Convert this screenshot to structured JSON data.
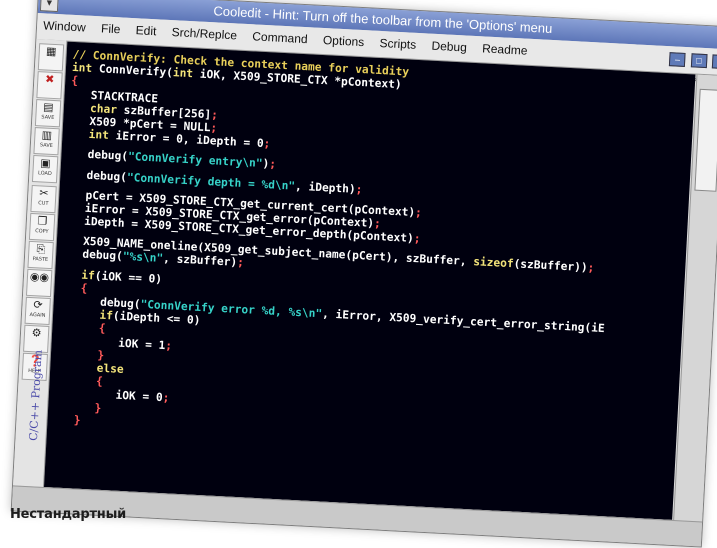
{
  "window": {
    "title": "Cooledit - Hint: Turn off the toolbar from the 'Options' menu",
    "system_menu_icon": "chevron-down-icon",
    "controls": [
      "minimize-icon",
      "maximize-icon",
      "close-icon"
    ]
  },
  "menu": {
    "items": [
      {
        "id": "window",
        "label": "Window"
      },
      {
        "id": "file",
        "label": "File"
      },
      {
        "id": "edit",
        "label": "Edit"
      },
      {
        "id": "srch-replace",
        "label": "Srch/Replce"
      },
      {
        "id": "command",
        "label": "Command"
      },
      {
        "id": "options",
        "label": "Options"
      },
      {
        "id": "scripts",
        "label": "Scripts"
      },
      {
        "id": "debug",
        "label": "Debug"
      },
      {
        "id": "readme",
        "label": "Readme"
      }
    ]
  },
  "toolbar": {
    "buttons": [
      {
        "id": "open",
        "icon": "open-folder-icon",
        "label": ""
      },
      {
        "id": "close",
        "icon": "close-icon",
        "label": ""
      },
      {
        "id": "save",
        "icon": "save-icon",
        "label": "SAVE"
      },
      {
        "id": "save-as",
        "icon": "save-as-icon",
        "label": "SAVE"
      },
      {
        "id": "load",
        "icon": "load-icon",
        "label": "LOAD"
      },
      {
        "id": "cut",
        "icon": "cut-icon",
        "label": "CUT"
      },
      {
        "id": "copy",
        "icon": "copy-icon",
        "label": "COPY"
      },
      {
        "id": "paste",
        "icon": "paste-icon",
        "label": "PASTE"
      },
      {
        "id": "search",
        "icon": "binoculars-icon",
        "label": ""
      },
      {
        "id": "again",
        "icon": "search-again-icon",
        "label": "AGAIN"
      },
      {
        "id": "run",
        "icon": "run-icon",
        "label": ""
      },
      {
        "id": "help",
        "icon": "help-icon",
        "label": "HELP"
      }
    ],
    "vertical_label": "C/C++ Program"
  },
  "editor": {
    "colors": {
      "background": "#00000f",
      "comment": "#e8cf5a",
      "keyword": "#f2e37a",
      "string": "#36d2c8",
      "punctuation": "#ff5a5a",
      "identifier": "#ffffff"
    },
    "lines": [
      [
        {
          "t": "// ConnVerify: Check the context name for validity",
          "c": "comment"
        }
      ],
      [
        {
          "t": "int ",
          "c": "type"
        },
        {
          "t": "ConnVerify(",
          "c": "id"
        },
        {
          "t": "int ",
          "c": "type"
        },
        {
          "t": "iOK, X509_STORE_CTX *pContext)",
          "c": "id"
        }
      ],
      [
        {
          "t": "{",
          "c": "punc"
        }
      ],
      [
        {
          "t": "   STACKTRACE",
          "c": "id"
        }
      ],
      [
        {
          "t": "   char ",
          "c": "type"
        },
        {
          "t": "szBuffer[256]",
          "c": "id"
        },
        {
          "t": ";",
          "c": "punc"
        }
      ],
      [
        {
          "t": "   X509 *pCert = NULL",
          "c": "id"
        },
        {
          "t": ";",
          "c": "punc"
        }
      ],
      [
        {
          "t": "   int ",
          "c": "type"
        },
        {
          "t": "iError = 0, iDepth = 0",
          "c": "id"
        },
        {
          "t": ";",
          "c": "punc"
        }
      ],
      [],
      [
        {
          "t": "   debug(",
          "c": "id"
        },
        {
          "t": "\"ConnVerify entry\\n\"",
          "c": "str"
        },
        {
          "t": ")",
          "c": "id"
        },
        {
          "t": ";",
          "c": "punc"
        }
      ],
      [],
      [
        {
          "t": "   debug(",
          "c": "id"
        },
        {
          "t": "\"ConnVerify depth = %d\\n\"",
          "c": "str"
        },
        {
          "t": ", iDepth)",
          "c": "id"
        },
        {
          "t": ";",
          "c": "punc"
        }
      ],
      [],
      [
        {
          "t": "   pCert = X509_STORE_CTX_get_current_cert(pContext)",
          "c": "id"
        },
        {
          "t": ";",
          "c": "punc"
        }
      ],
      [
        {
          "t": "   iError = X509_STORE_CTX_get_error(pContext)",
          "c": "id"
        },
        {
          "t": ";",
          "c": "punc"
        }
      ],
      [
        {
          "t": "   iDepth = X509_STORE_CTX_get_error_depth(pContext)",
          "c": "id"
        },
        {
          "t": ";",
          "c": "punc"
        }
      ],
      [],
      [
        {
          "t": "   X509_NAME_oneline(X509_get_subject_name(pCert), szBuffer, ",
          "c": "id"
        },
        {
          "t": "sizeof",
          "c": "kw"
        },
        {
          "t": "(szBuffer))",
          "c": "id"
        },
        {
          "t": ";",
          "c": "punc"
        }
      ],
      [
        {
          "t": "   debug(",
          "c": "id"
        },
        {
          "t": "\"%s\\n\"",
          "c": "str"
        },
        {
          "t": ", szBuffer)",
          "c": "id"
        },
        {
          "t": ";",
          "c": "punc"
        }
      ],
      [],
      [
        {
          "t": "   if",
          "c": "kw"
        },
        {
          "t": "(iOK == 0)",
          "c": "id"
        }
      ],
      [
        {
          "t": "   {",
          "c": "punc"
        }
      ],
      [
        {
          "t": "      debug(",
          "c": "id"
        },
        {
          "t": "\"ConnVerify error %d, %s\\n\"",
          "c": "str"
        },
        {
          "t": ", iError, X509_verify_cert_error_string(iE",
          "c": "id"
        }
      ],
      [
        {
          "t": "      if",
          "c": "kw"
        },
        {
          "t": "(iDepth <= 0)",
          "c": "id"
        }
      ],
      [
        {
          "t": "      {",
          "c": "punc"
        }
      ],
      [
        {
          "t": "         iOK = 1",
          "c": "id"
        },
        {
          "t": ";",
          "c": "punc"
        }
      ],
      [
        {
          "t": "      }",
          "c": "punc"
        }
      ],
      [
        {
          "t": "      else",
          "c": "kw"
        }
      ],
      [
        {
          "t": "      {",
          "c": "punc"
        }
      ],
      [
        {
          "t": "         iOK = 0",
          "c": "id"
        },
        {
          "t": ";",
          "c": "punc"
        }
      ],
      [
        {
          "t": "      }",
          "c": "punc"
        }
      ],
      [
        {
          "t": "   }",
          "c": "punc"
        }
      ]
    ]
  },
  "caption": "Нестандартный"
}
